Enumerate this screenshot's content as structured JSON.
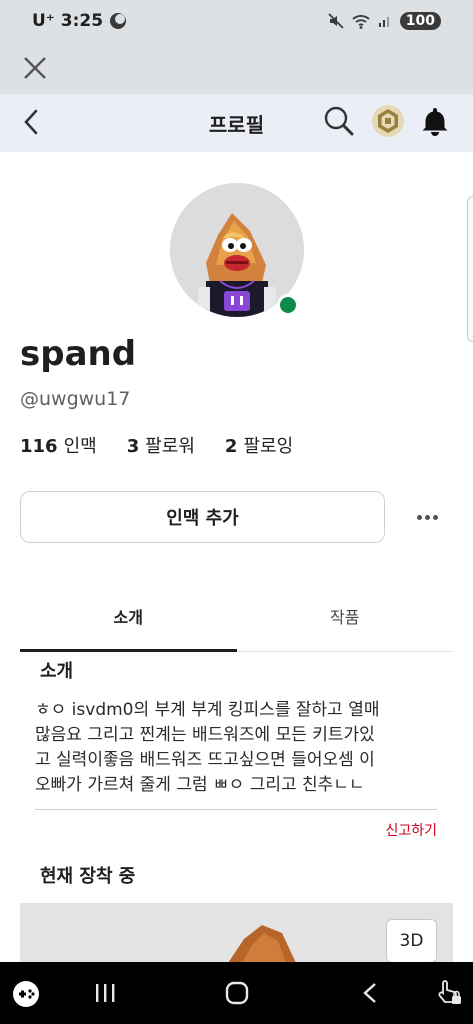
{
  "status_bar": {
    "carrier": "U⁺",
    "time": "3:25",
    "battery": "100"
  },
  "nav": {
    "title": "프로필"
  },
  "profile": {
    "username": "spand",
    "handle": "@uwgwu17",
    "stats": [
      {
        "value": "116",
        "label": "인맥"
      },
      {
        "value": "3",
        "label": "팔로워"
      },
      {
        "value": "2",
        "label": "팔로잉"
      }
    ],
    "add_button_label": "인맥 추가"
  },
  "tabs": [
    {
      "label": "소개",
      "active": true
    },
    {
      "label": "작품",
      "active": false
    }
  ],
  "about": {
    "heading": "소개",
    "body_lines": [
      "ㅎㅇ isvdm0의 부계 부계 킹피스를 잘하고 열매",
      "많음요 그리고 찐계는 배드워즈에 모든 키트가있",
      "고 실력이좋음 배드워즈 뜨고싶으면 들어오셈 이",
      "오빠가 가르쳐 줄게 그럼 ㅃㅇ 그리고 친추ㄴㄴ"
    ],
    "report_label": "신고하기"
  },
  "wearing": {
    "heading": "현재 장착 중",
    "view_3d_label": "3D"
  },
  "colors": {
    "online": "#0e8a4b",
    "report": "#d0021b",
    "status_bar_bg": "#dde1e4",
    "nav_bg": "#eceef7"
  }
}
